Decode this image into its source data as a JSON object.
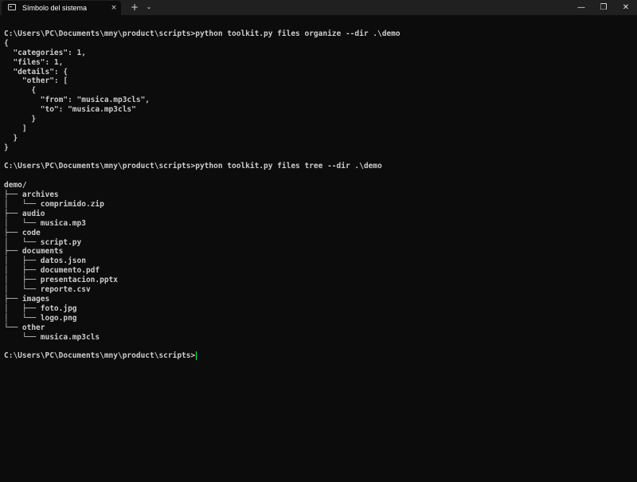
{
  "window": {
    "tab_title": "Símbolo del sistema",
    "tab_close_icon": "×",
    "new_tab_icon": "+",
    "dropdown_icon": "⌄",
    "minimize_icon": "—",
    "maximize_icon": "❐",
    "close_icon": "✕"
  },
  "terminal": {
    "lines": [
      "C:\\Users\\PC\\Documents\\mny\\product\\scripts>python toolkit.py files organize --dir .\\demo",
      "{",
      "  \"categories\": 1,",
      "  \"files\": 1,",
      "  \"details\": {",
      "    \"other\": [",
      "      {",
      "        \"from\": \"musica.mp3cls\",",
      "        \"to\": \"musica.mp3cls\"",
      "      }",
      "    ]",
      "  }",
      "}",
      "",
      "C:\\Users\\PC\\Documents\\mny\\product\\scripts>python toolkit.py files tree --dir .\\demo",
      "",
      "demo/",
      "├── archives",
      "│   └── comprimido.zip",
      "├── audio",
      "│   └── musica.mp3",
      "├── code",
      "│   └── script.py",
      "├── documents",
      "│   ├── datos.json",
      "│   ├── documento.pdf",
      "│   ├── presentacion.pptx",
      "│   └── reporte.csv",
      "├── images",
      "│   ├── foto.jpg",
      "│   └── logo.png",
      "└── other",
      "    └── musica.mp3cls",
      ""
    ],
    "prompt": "C:\\Users\\PC\\Documents\\mny\\product\\scripts>",
    "cursor_color": "#00ff66"
  },
  "colors": {
    "background": "#0c0c0c",
    "titlebar": "#202020",
    "text": "#cccccc"
  }
}
